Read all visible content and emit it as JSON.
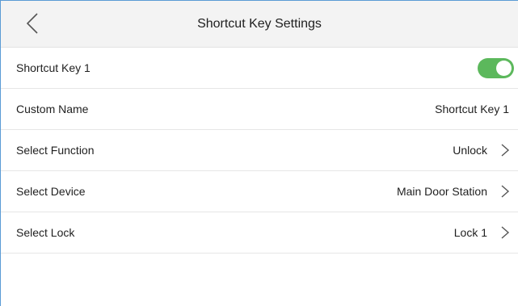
{
  "header": {
    "title": "Shortcut Key Settings",
    "back_icon": "chevron-left-icon"
  },
  "rows": [
    {
      "label": "Shortcut Key 1",
      "control": "toggle",
      "enabled": true
    },
    {
      "label": "Custom Name",
      "value": "Shortcut Key 1"
    },
    {
      "label": "Select Function",
      "value": "Unlock",
      "icon": "chevron-right-icon"
    },
    {
      "label": "Select Device",
      "value": "Main Door Station",
      "icon": "chevron-right-icon"
    },
    {
      "label": "Select Lock",
      "value": "Lock 1",
      "icon": "chevron-right-icon"
    }
  ],
  "colors": {
    "toggle_on": "#5cb85c",
    "frame_border": "#5b9bd5",
    "header_bg": "#f3f3f3"
  }
}
